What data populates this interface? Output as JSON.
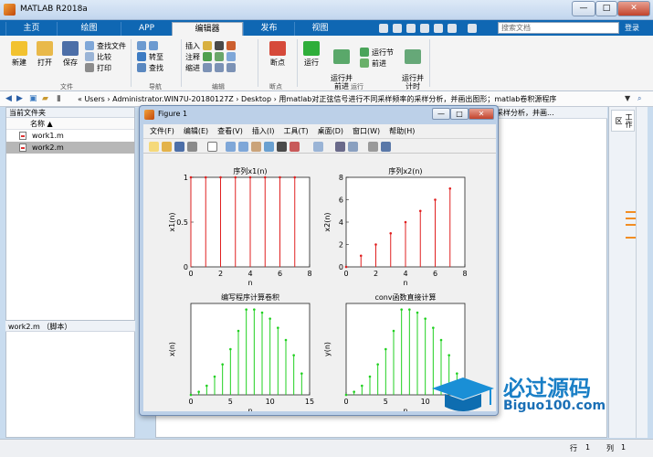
{
  "window": {
    "title": "MATLAB R2018a",
    "min": "—",
    "max": "□",
    "close": "✕"
  },
  "tabs": [
    "主页",
    "绘图",
    "APP",
    "编辑器",
    "发布",
    "视图"
  ],
  "search": {
    "placeholder": "搜索文档",
    "signin": "登录"
  },
  "ribbon": {
    "file_group": {
      "label": "文件",
      "new": "新建",
      "open": "打开",
      "save": "保存",
      "find_files": "查找文件",
      "compare": "比较",
      "print": "打印"
    },
    "nav_group": {
      "label": "导航",
      "goto": "转至",
      "find": "查找"
    },
    "edit_group": {
      "label": "编辑",
      "insert": "插入",
      "comment": "注释",
      "indent": "缩进"
    },
    "breakpoints_group": {
      "label": "断点",
      "breakpoints": "断点"
    },
    "run_group": {
      "label": "运行",
      "run": "运行",
      "run_advance": "运行并\n前进",
      "run_section": "运行节",
      "advance": "前进",
      "run_time": "运行并\n计时"
    }
  },
  "address": {
    "path": "«  Users  ›  Administrator.WIN7U-20180127Z  ›  Desktop  ›  用matlab对正弦信号进行不同采样频率的采样分析，并画出图形；matlab卷积源程序"
  },
  "current_folder": {
    "title": "当前文件夹",
    "column": "名称 ▲",
    "files": [
      "work1.m",
      "work2.m"
    ],
    "detail": "work2.m  （脚本）"
  },
  "editor_tab_text": "采样频率的采样分析，并画...",
  "right_label": "工作区",
  "status": {
    "line_label": "行",
    "line_val": "1",
    "col_label": "列",
    "col_val": "1"
  },
  "figure": {
    "title": "Figure 1",
    "menu": [
      "文件(F)",
      "编辑(E)",
      "查看(V)",
      "插入(I)",
      "工具(T)",
      "桌面(D)",
      "窗口(W)",
      "帮助(H)"
    ]
  },
  "colors": {
    "stem_red": "#e02020",
    "stem_green": "#20d020",
    "ribbon_blue": "#0f67b3"
  },
  "chart_data": [
    {
      "type": "stem",
      "title": "序列x1(n)",
      "xlabel": "n",
      "ylabel": "x1(n)",
      "xlim": [
        0,
        8
      ],
      "ylim": [
        0,
        1
      ],
      "xticks": [
        0,
        2,
        4,
        6,
        8
      ],
      "yticks": [
        0,
        0.5,
        1
      ],
      "x": [
        0,
        1,
        2,
        3,
        4,
        5,
        6,
        7
      ],
      "y": [
        1,
        1,
        1,
        1,
        1,
        1,
        1,
        1
      ],
      "color": "#e02020"
    },
    {
      "type": "stem",
      "title": "序列x2(n)",
      "xlabel": "n",
      "ylabel": "x2(n)",
      "xlim": [
        0,
        8
      ],
      "ylim": [
        0,
        8
      ],
      "xticks": [
        0,
        2,
        4,
        6,
        8
      ],
      "yticks": [
        0,
        2,
        4,
        6,
        8
      ],
      "x": [
        0,
        1,
        2,
        3,
        4,
        5,
        6,
        7
      ],
      "y": [
        0,
        1,
        2,
        3,
        4,
        5,
        6,
        7
      ],
      "color": "#e02020"
    },
    {
      "type": "stem",
      "title": "编写程序计算卷积",
      "xlabel": "n",
      "ylabel": "x(n)",
      "xlim": [
        0,
        15
      ],
      "ylim": [
        0,
        30
      ],
      "xticks": [
        0,
        5,
        10,
        15
      ],
      "yticks": [],
      "x": [
        0,
        1,
        2,
        3,
        4,
        5,
        6,
        7,
        8,
        9,
        10,
        11,
        12,
        13,
        14
      ],
      "y": [
        0,
        1,
        3,
        6,
        10,
        15,
        21,
        28,
        28,
        27,
        25,
        22,
        18,
        13,
        7
      ],
      "color": "#20d020"
    },
    {
      "type": "stem",
      "title": "conv函数直接计算",
      "xlabel": "n",
      "ylabel": "y(n)",
      "xlim": [
        0,
        15
      ],
      "ylim": [
        0,
        30
      ],
      "xticks": [
        0,
        5,
        10
      ],
      "yticks": [],
      "x": [
        0,
        1,
        2,
        3,
        4,
        5,
        6,
        7,
        8,
        9,
        10,
        11,
        12,
        13,
        14
      ],
      "y": [
        0,
        1,
        3,
        6,
        10,
        15,
        21,
        28,
        28,
        27,
        25,
        22,
        18,
        13,
        7
      ],
      "color": "#20d020"
    }
  ],
  "watermark": {
    "text_cn": "必过源码",
    "text_url": "Biguo100.com"
  }
}
